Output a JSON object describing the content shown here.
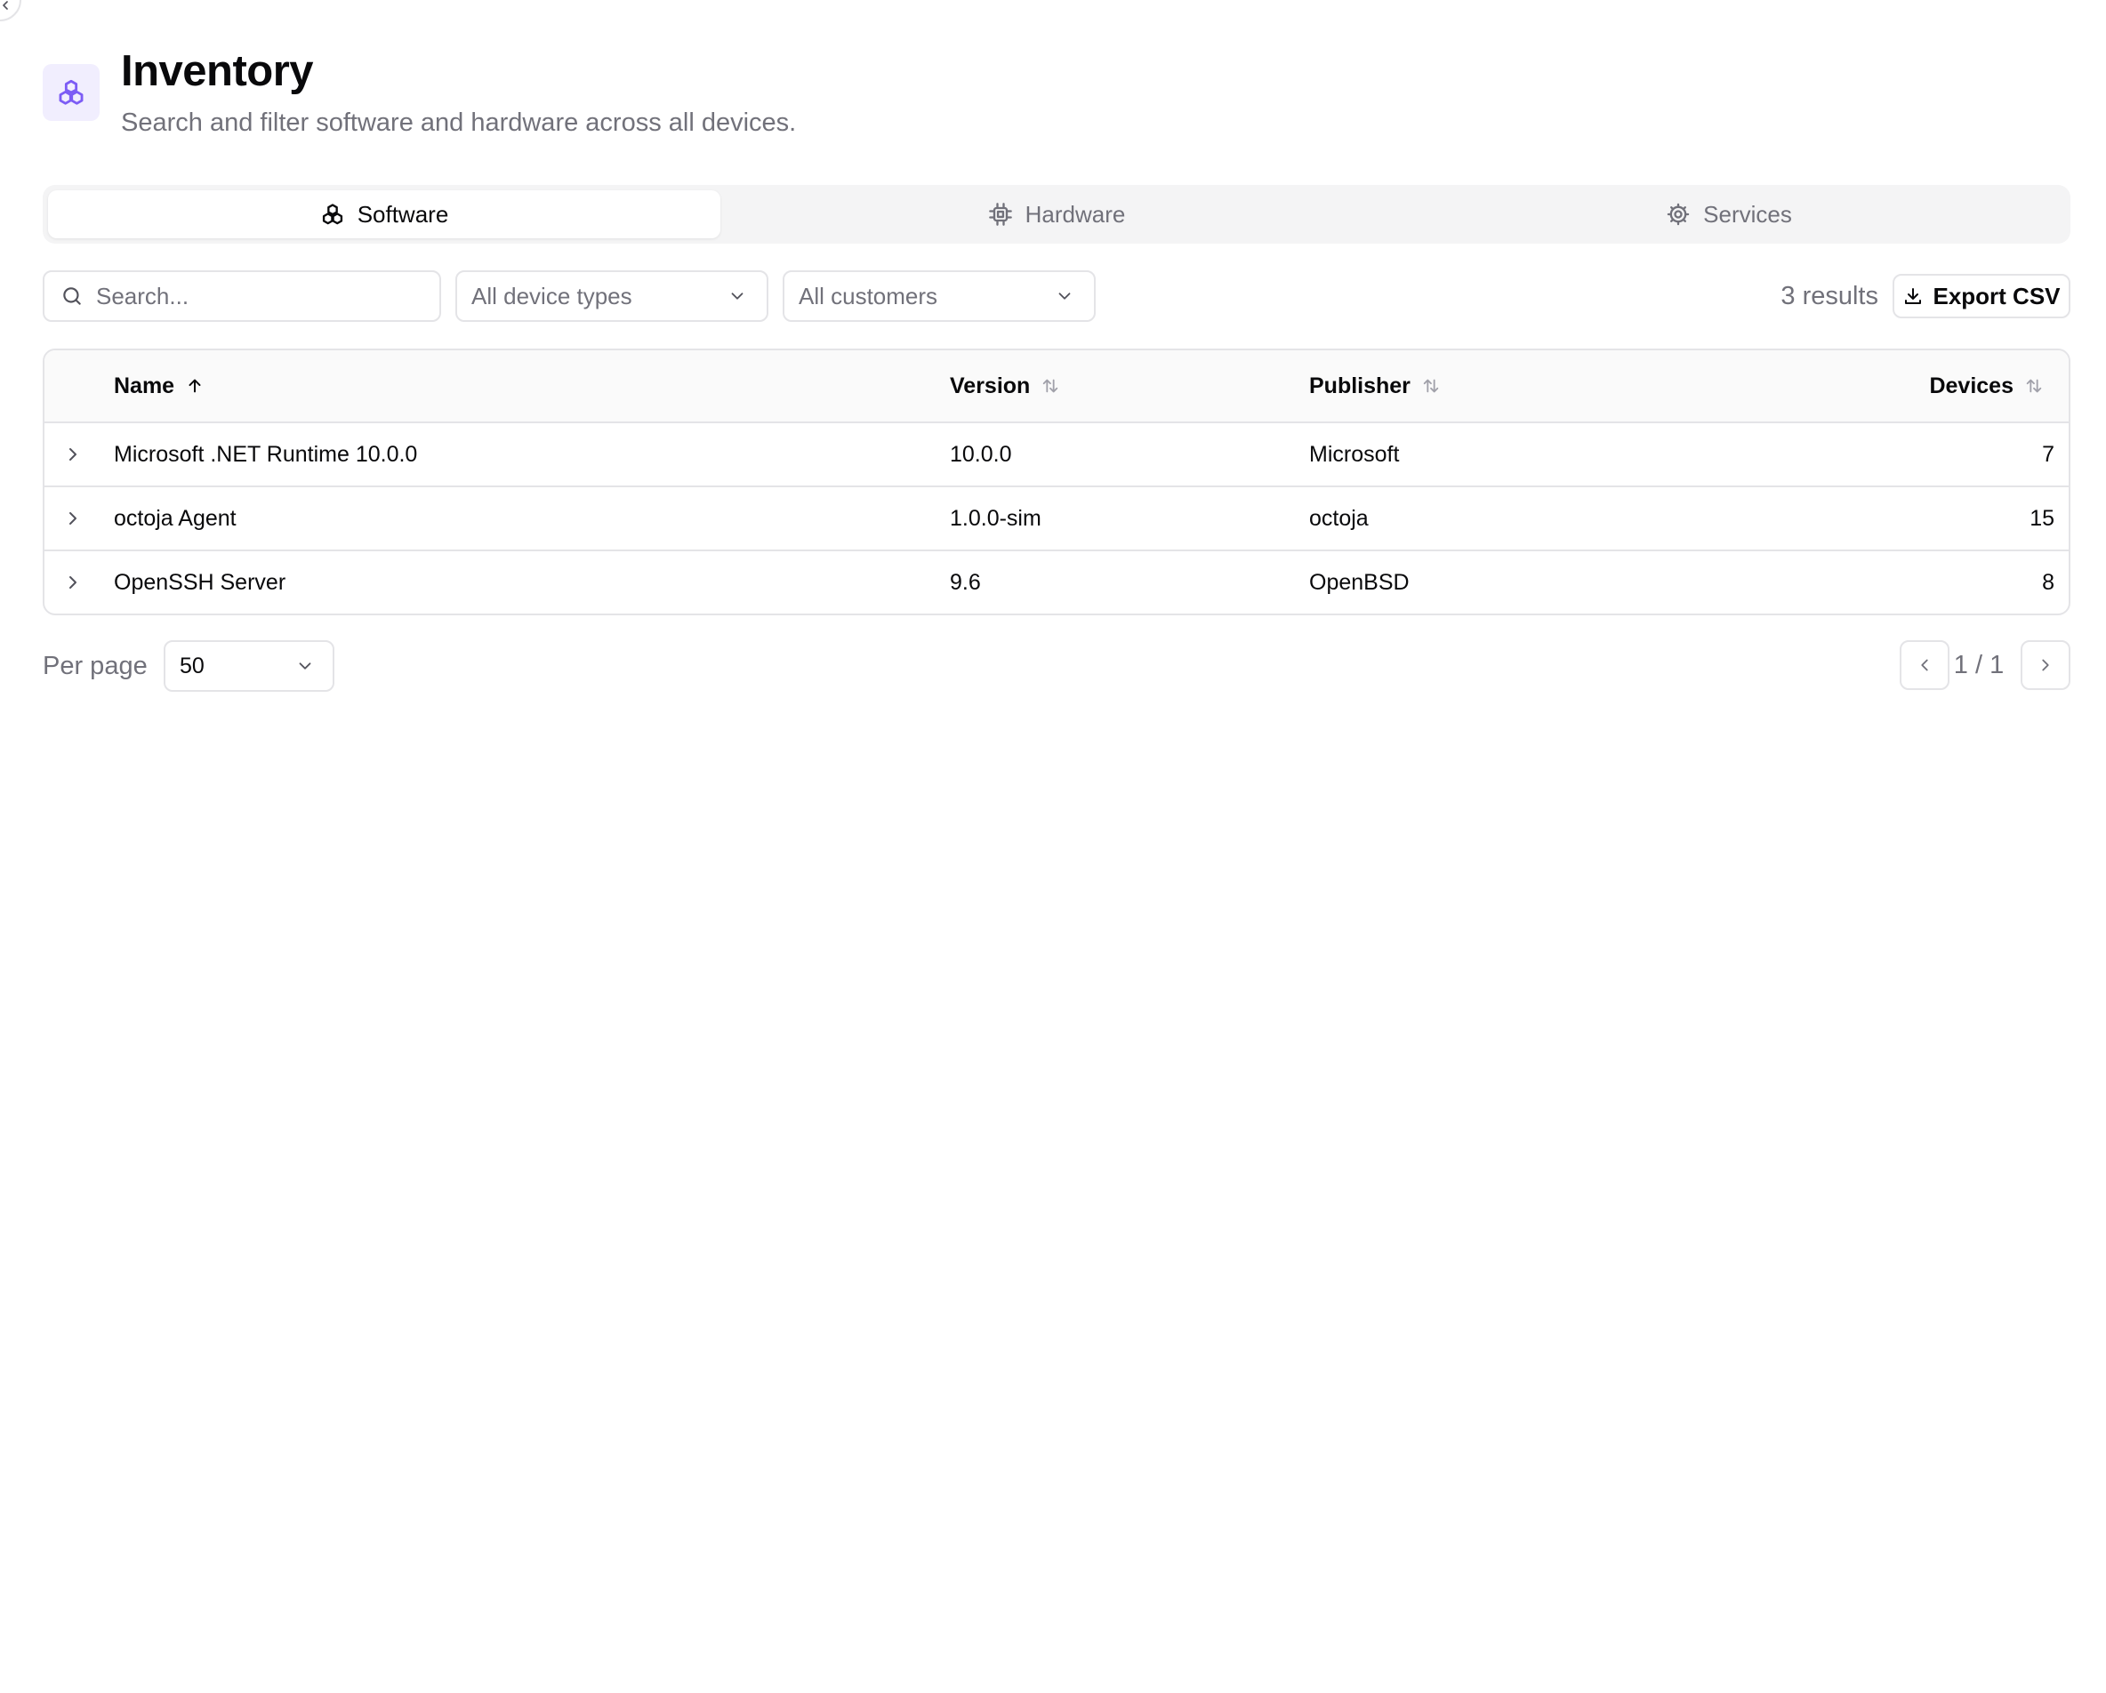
{
  "header": {
    "title": "Inventory",
    "subtitle": "Search and filter software and hardware across all devices.",
    "icon": "boxes-icon"
  },
  "tabs": [
    {
      "label": "Software",
      "icon": "boxes-icon",
      "active": true
    },
    {
      "label": "Hardware",
      "icon": "cpu-icon",
      "active": false
    },
    {
      "label": "Services",
      "icon": "gear-icon",
      "active": false
    }
  ],
  "filters": {
    "search_placeholder": "Search...",
    "device_type": "All device types",
    "customer": "All customers",
    "results": "3 results",
    "export_label": "Export CSV"
  },
  "table": {
    "columns": [
      {
        "label": "Name",
        "sort": "asc"
      },
      {
        "label": "Version",
        "sort": "none"
      },
      {
        "label": "Publisher",
        "sort": "none"
      },
      {
        "label": "Devices",
        "sort": "none"
      }
    ],
    "rows": [
      {
        "name": "Microsoft .NET Runtime 10.0.0",
        "version": "10.0.0",
        "publisher": "Microsoft",
        "devices": "7"
      },
      {
        "name": "octoja Agent",
        "version": "1.0.0-sim",
        "publisher": "octoja",
        "devices": "15"
      },
      {
        "name": "OpenSSH Server",
        "version": "9.6",
        "publisher": "OpenBSD",
        "devices": "8"
      }
    ]
  },
  "pagination": {
    "per_page_label": "Per page",
    "per_page_value": "50",
    "page_text": "1 / 1"
  },
  "colors": {
    "accent": "#7c5cf5",
    "accent_bg": "#f1eefe",
    "border": "#e4e4e7",
    "muted": "#71717a"
  }
}
